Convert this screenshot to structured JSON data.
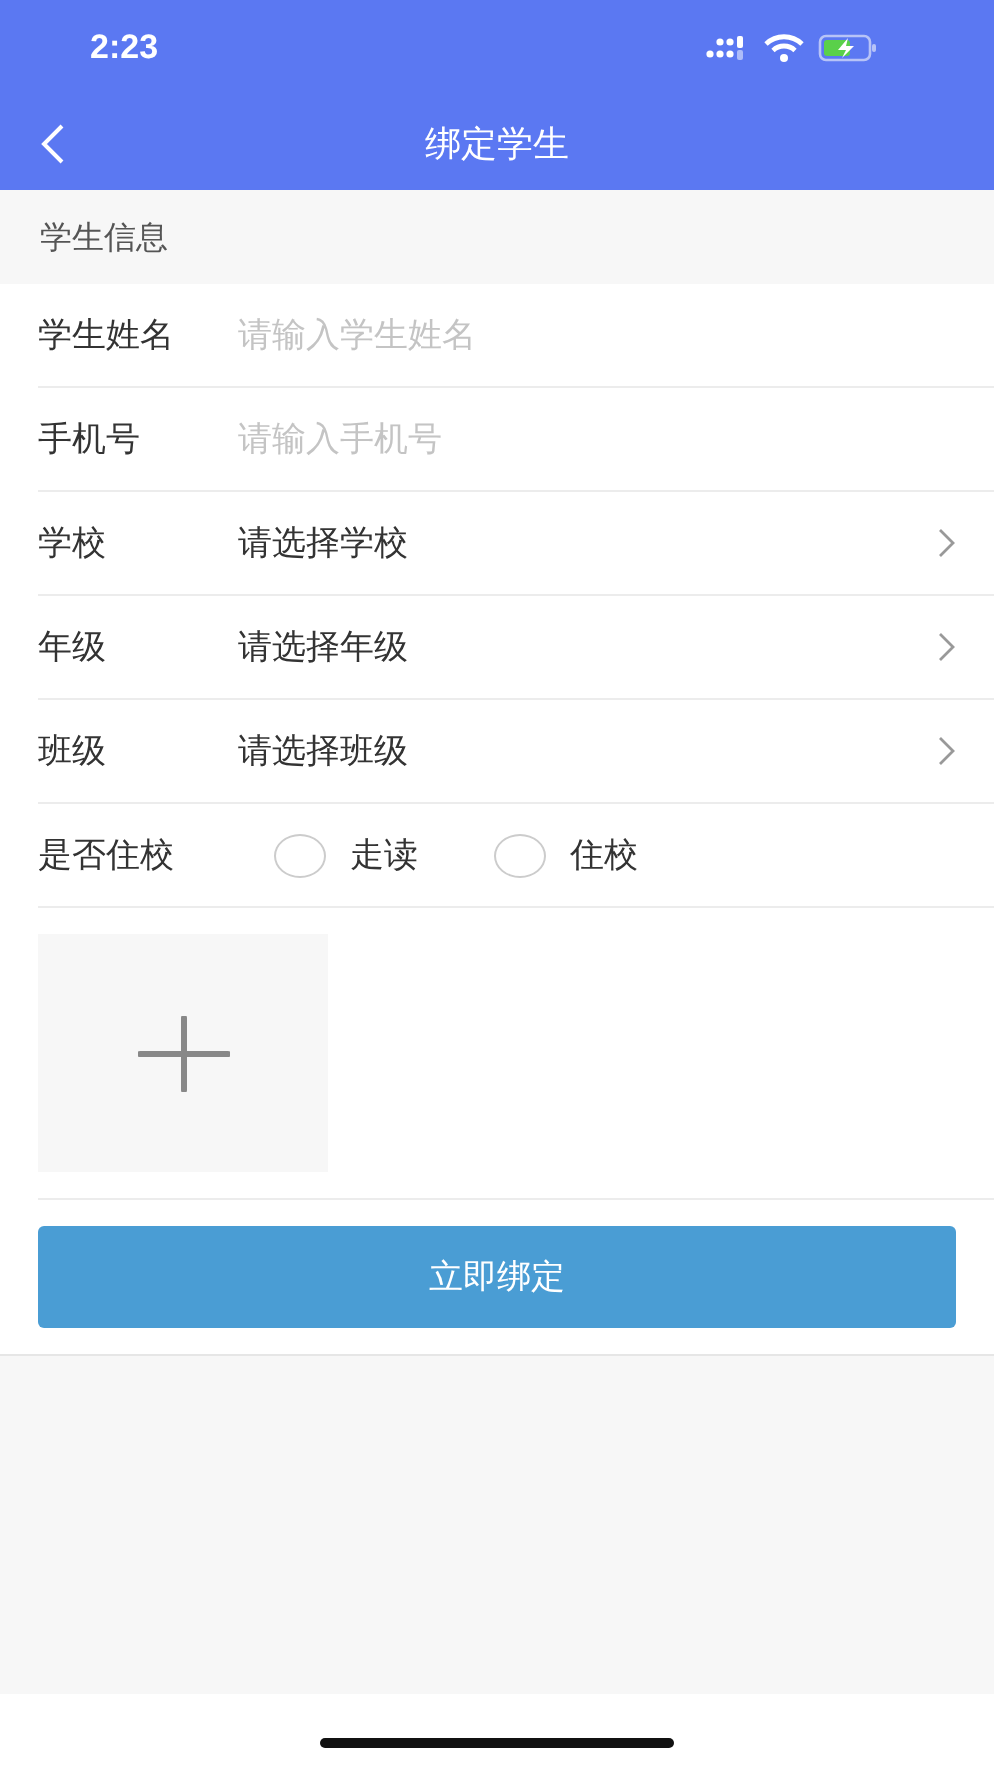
{
  "status_bar": {
    "time": "2:23"
  },
  "nav": {
    "title": "绑定学生"
  },
  "section": {
    "title": "学生信息"
  },
  "rows": [
    {
      "kind": "input",
      "label": "学生姓名",
      "placeholder": "请输入学生姓名"
    },
    {
      "kind": "input",
      "label": "手机号",
      "placeholder": "请输入手机号"
    },
    {
      "kind": "select",
      "label": "学校",
      "value": "请选择学校"
    },
    {
      "kind": "select",
      "label": "年级",
      "value": "请选择年级"
    },
    {
      "kind": "select",
      "label": "班级",
      "value": "请选择班级"
    }
  ],
  "boarding": {
    "label": "是否住校",
    "options": [
      {
        "label": "走读",
        "selected": false
      },
      {
        "label": "住校",
        "selected": false
      }
    ]
  },
  "submit": {
    "label": "立即绑定"
  }
}
